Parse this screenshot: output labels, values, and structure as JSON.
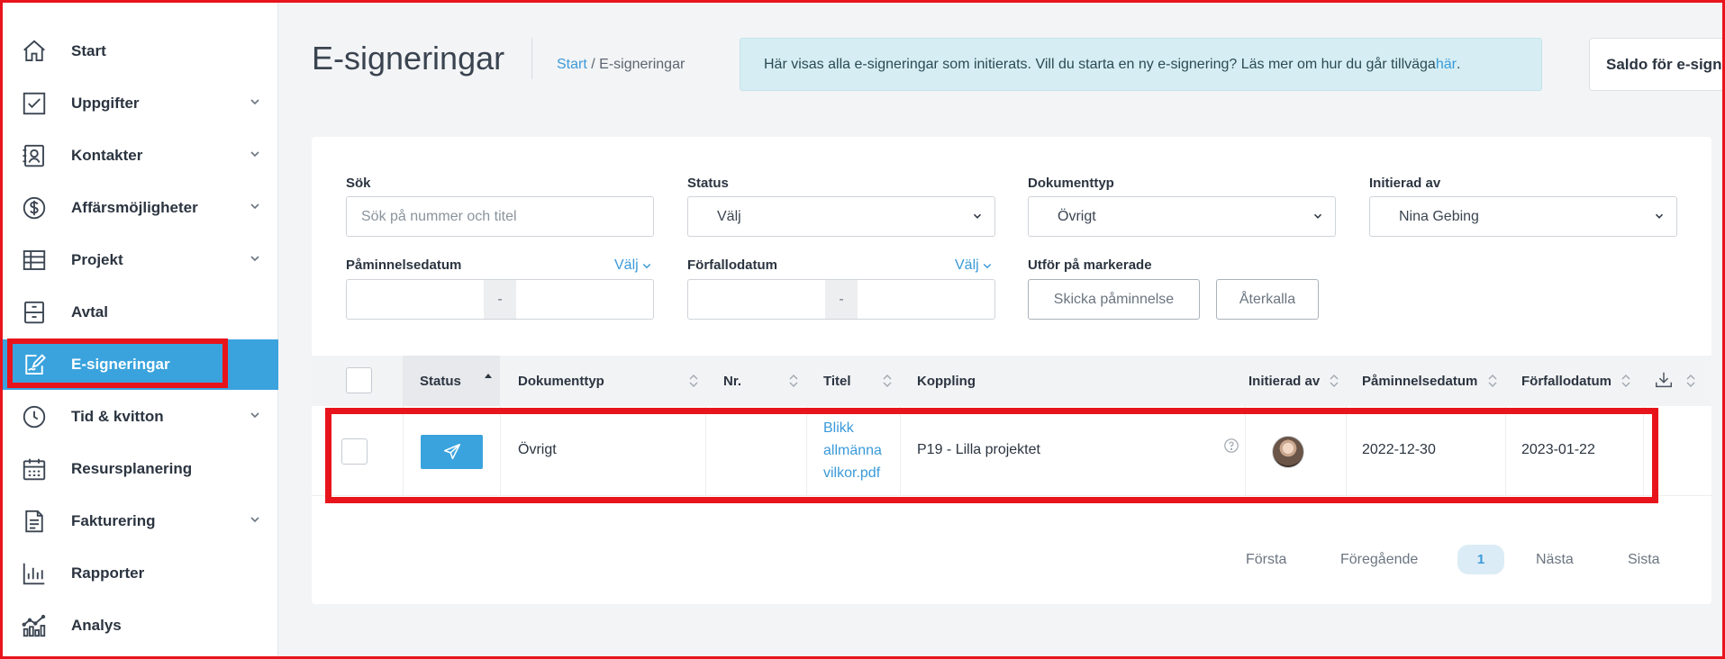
{
  "sidebar": {
    "items": [
      {
        "label": "Start",
        "icon": "home-icon",
        "has_chevron": false
      },
      {
        "label": "Uppgifter",
        "icon": "checkbox-icon",
        "has_chevron": true
      },
      {
        "label": "Kontakter",
        "icon": "contact-book-icon",
        "has_chevron": true
      },
      {
        "label": "Affärsmöjligheter",
        "icon": "dollar-circle-icon",
        "has_chevron": true
      },
      {
        "label": "Projekt",
        "icon": "table-icon",
        "has_chevron": true
      },
      {
        "label": "Avtal",
        "icon": "archive-icon",
        "has_chevron": false
      },
      {
        "label": "E-signeringar",
        "icon": "signature-pen-icon",
        "has_chevron": false,
        "active": true
      },
      {
        "label": "Tid & kvitton",
        "icon": "clock-icon",
        "has_chevron": true
      },
      {
        "label": "Resursplanering",
        "icon": "calendar-icon",
        "has_chevron": false
      },
      {
        "label": "Fakturering",
        "icon": "document-icon",
        "has_chevron": true
      },
      {
        "label": "Rapporter",
        "icon": "bar-chart-icon",
        "has_chevron": false
      },
      {
        "label": "Analys",
        "icon": "analytics-icon",
        "has_chevron": false
      }
    ]
  },
  "header": {
    "title": "E-signeringar",
    "breadcrumb_link": "Start",
    "breadcrumb_sep": " / ",
    "breadcrumb_current": "E-signeringar",
    "banner_text": "Här visas alla e-signeringar som initierats. Vill du starta en ny e-signering? Läs mer om hur du går tillväga ",
    "banner_link": "här",
    "banner_end": ".",
    "saldo_label": "Saldo för e-signe"
  },
  "filters": {
    "search_label": "Sök",
    "search_placeholder": "Sök på nummer och titel",
    "status_label": "Status",
    "status_value": "Välj",
    "doctype_label": "Dokumenttyp",
    "doctype_value": "Övrigt",
    "initiated_label": "Initierad av",
    "initiated_value": "Nina Gebing",
    "reminder_label": "Påminnelsedatum",
    "reminder_pick": "Välj",
    "due_label": "Förfallodatum",
    "due_pick": "Välj",
    "range_sep": "-",
    "bulk_label": "Utför på markerade",
    "send_reminder_btn": "Skicka påminnelse",
    "revoke_btn": "Återkalla"
  },
  "table": {
    "columns": {
      "status": "Status",
      "doctype": "Dokumenttyp",
      "nr": "Nr.",
      "title": "Titel",
      "link": "Koppling",
      "initiated": "Initierad av",
      "reminder": "Påminnelsedatum",
      "due": "Förfallodatum"
    },
    "rows": [
      {
        "status_icon": "paper-plane-icon",
        "doctype": "Övrigt",
        "nr": "",
        "title": "Blikk allmänna vilkor.pdf",
        "link": "P19 - Lilla projektet",
        "reminder": "2022-12-30",
        "due": "2023-01-22"
      }
    ]
  },
  "pagination": {
    "first": "Första",
    "prev": "Föregående",
    "current": "1",
    "next": "Nästa",
    "last": "Sista"
  },
  "colors": {
    "accent": "#3aa3dd",
    "highlight": "#e8141c",
    "banner_bg": "#d6eef3"
  }
}
